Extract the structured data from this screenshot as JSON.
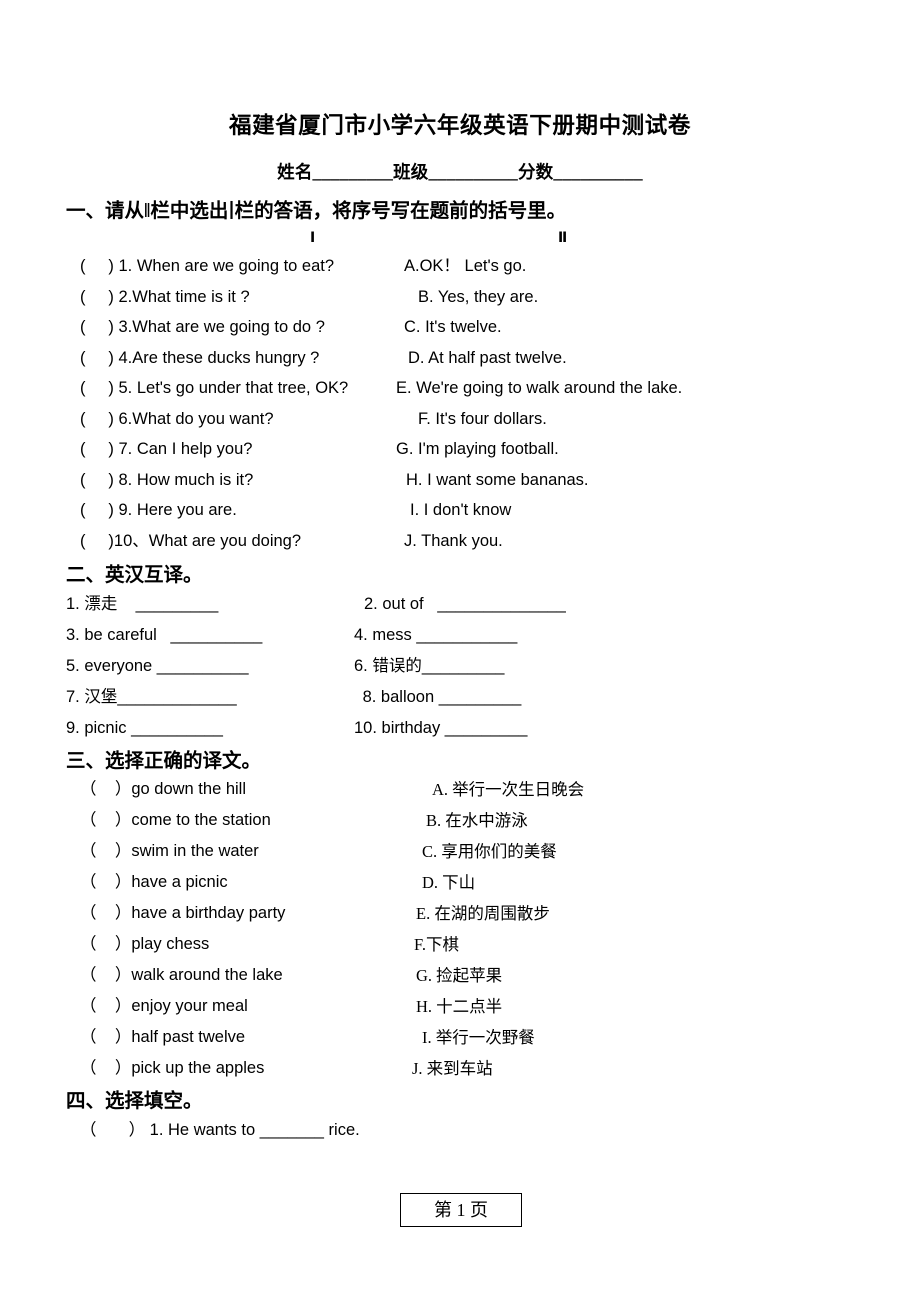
{
  "document": {
    "title": "福建省厦门市小学六年级英语下册期中测试卷",
    "identity_line": "姓名_________班级__________分数__________",
    "footer": "第 1 页"
  },
  "section1": {
    "heading": "一、请从‖栏中选出∣栏的答语，将序号写在题前的括号里。",
    "column_header_left": "Ⅰ",
    "column_header_right": "Ⅱ",
    "questions": [
      "(     ) 1. When are we going to eat?",
      "(     ) 2.What time is it ?",
      "(     ) 3.What are we going to do ?",
      "(     ) 4.Are these ducks hungry ?",
      "(     ) 5. Let's go under that tree, OK?",
      "(     ) 6.What do you want?",
      "(     ) 7. Can I help you?",
      "(     ) 8. How much is it?",
      "(     ) 9. Here you are.",
      "(     )10、What are you doing?"
    ],
    "answers": [
      "A.OK！ Let's go.",
      "B. Yes, they are.",
      "C. It's twelve.",
      "D. At half past twelve.",
      "E. We're going to walk around the lake.",
      "F. It's four dollars.",
      "G. I'm playing football.",
      "H. I want some bananas.",
      "I. I don't know",
      "J. Thank you."
    ],
    "answer_offsets": [
      338,
      352,
      338,
      342,
      330,
      352,
      330,
      340,
      344,
      338
    ]
  },
  "section2": {
    "heading": "二、英汉互译。",
    "left_items": [
      "1. 漂走    _________",
      "3. be careful   __________",
      "5. everyone __________",
      "7. 汉堡_____________",
      "9. picnic __________"
    ],
    "right_items": [
      "2. out of   ______________",
      "4. mess ___________",
      "6. 错误的_________",
      " 8. balloon _________",
      "10. birthday _________"
    ],
    "right_offsets": [
      298,
      288,
      288,
      292,
      288
    ]
  },
  "section3": {
    "heading": "三、选择正确的译文。",
    "questions": [
      "（    ）go down the hill",
      "（    ）come to the station",
      "（    ）swim in the water",
      "（    ）have a picnic",
      "（    ）have a birthday party",
      "（    ）play chess",
      "（    ）walk around the lake",
      "（    ）enjoy your meal",
      "（    ）half past twelve",
      "（    ）pick up the apples"
    ],
    "answers": [
      "A. 举行一次生日晚会",
      "B. 在水中游泳",
      "C. 享用你们的美餐",
      "D. 下山",
      "E. 在湖的周围散步",
      "F.下棋",
      "G. 捡起苹果",
      "H. 十二点半",
      "I. 举行一次野餐",
      "J. 来到车站"
    ],
    "answer_offsets": [
      366,
      360,
      356,
      356,
      350,
      348,
      350,
      350,
      356,
      346
    ]
  },
  "section4": {
    "heading": "四、选择填空。",
    "items": [
      "（       ） 1. He wants to _______ rice."
    ]
  }
}
